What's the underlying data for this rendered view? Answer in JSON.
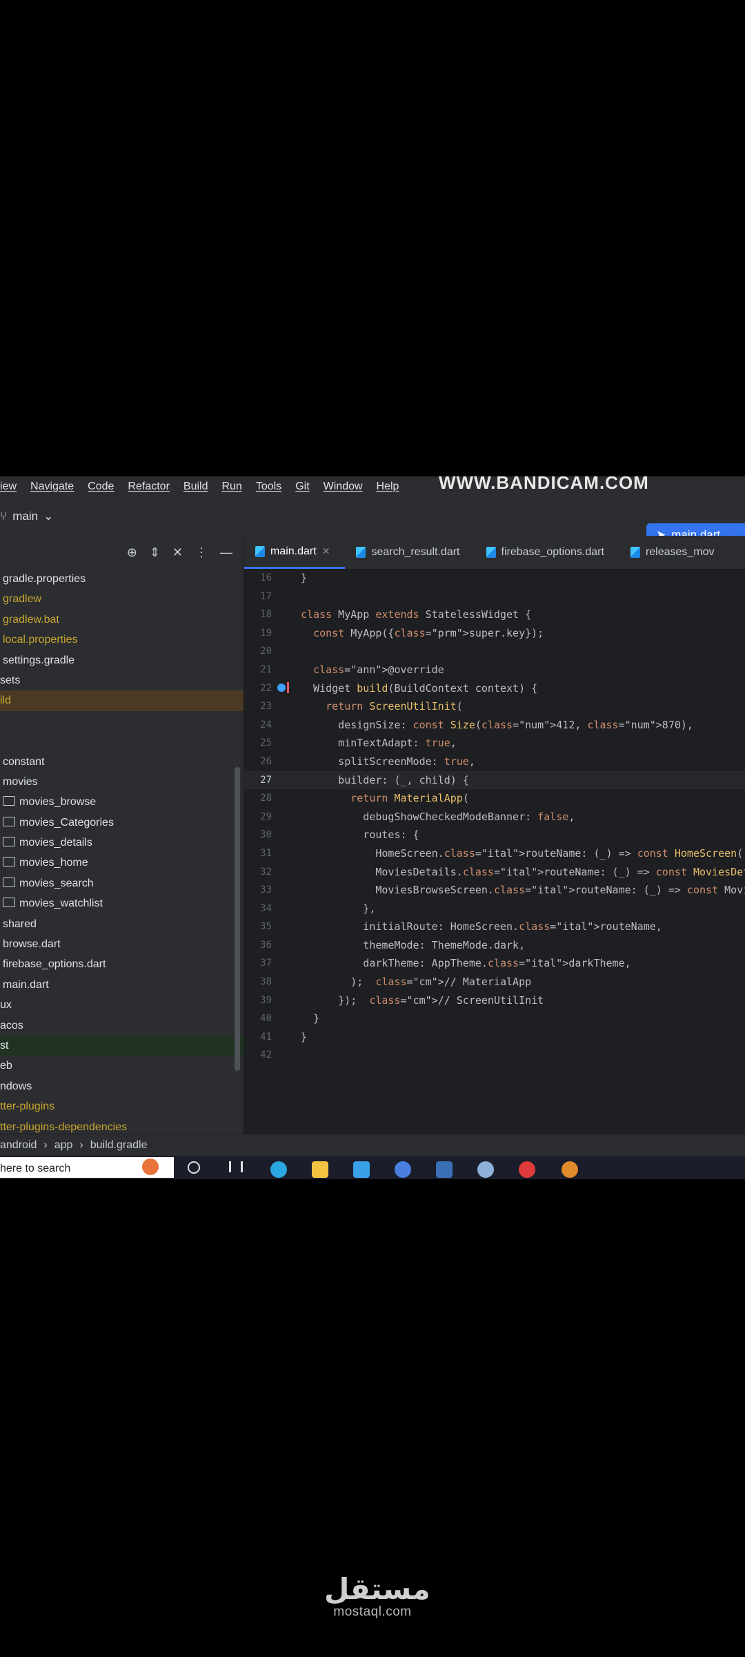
{
  "menu": [
    "iew",
    "Navigate",
    "Code",
    "Refactor",
    "Build",
    "Run",
    "Tools",
    "Git",
    "Window",
    "Help"
  ],
  "watermark": "WWW.BANDICAM.COM",
  "toolbar": {
    "branch": "main",
    "run_config": "main.dart"
  },
  "project_header_icons": [
    "target-icon",
    "expand-collapse-icon",
    "close-icon",
    "more-icon",
    "minimize-icon"
  ],
  "tree": [
    {
      "label": "gradle.properties",
      "color": "normal",
      "indent": 0
    },
    {
      "label": "gradlew",
      "color": "yellow",
      "indent": 0
    },
    {
      "label": "gradlew.bat",
      "color": "yellow",
      "indent": 0
    },
    {
      "label": "local.properties",
      "color": "yellow",
      "indent": 0
    },
    {
      "label": "settings.gradle",
      "color": "normal",
      "indent": 0
    },
    {
      "label": "sets",
      "color": "normal",
      "indent": -1
    },
    {
      "label": "ild",
      "color": "yellow",
      "indent": -1,
      "highlight": "brown"
    },
    {
      "label": "",
      "color": "normal",
      "indent": -1
    },
    {
      "label": "",
      "color": "normal",
      "indent": -1
    },
    {
      "label": "constant",
      "color": "normal",
      "indent": 0
    },
    {
      "label": "movies",
      "color": "normal",
      "indent": 0
    },
    {
      "label": "movies_browse",
      "color": "normal",
      "indent": 1,
      "folder": true
    },
    {
      "label": "movies_Categories",
      "color": "normal",
      "indent": 1,
      "folder": true
    },
    {
      "label": "movies_details",
      "color": "normal",
      "indent": 1,
      "folder": true
    },
    {
      "label": "movies_home",
      "color": "normal",
      "indent": 1,
      "folder": true
    },
    {
      "label": "movies_search",
      "color": "normal",
      "indent": 1,
      "folder": true
    },
    {
      "label": "movies_watchlist",
      "color": "normal",
      "indent": 1,
      "folder": true
    },
    {
      "label": "shared",
      "color": "normal",
      "indent": 0
    },
    {
      "label": "browse.dart",
      "color": "normal",
      "indent": 0
    },
    {
      "label": "firebase_options.dart",
      "color": "normal",
      "indent": 0
    },
    {
      "label": "main.dart",
      "color": "normal",
      "indent": 0
    },
    {
      "label": "ux",
      "color": "normal",
      "indent": -1
    },
    {
      "label": "acos",
      "color": "normal",
      "indent": -1
    },
    {
      "label": "st",
      "color": "normal",
      "indent": -1,
      "highlight": "green"
    },
    {
      "label": "eb",
      "color": "normal",
      "indent": -1
    },
    {
      "label": "ndows",
      "color": "normal",
      "indent": -1
    },
    {
      "label": "tter-plugins",
      "color": "yellow",
      "indent": -1
    },
    {
      "label": "tter-plugins-dependencies",
      "color": "yellow",
      "indent": -1
    }
  ],
  "tabs": [
    {
      "label": "main.dart",
      "active": true,
      "closable": true
    },
    {
      "label": "search_result.dart",
      "active": false
    },
    {
      "label": "firebase_options.dart",
      "active": false
    },
    {
      "label": "releases_mov",
      "active": false
    }
  ],
  "code": {
    "current_line": 27,
    "lines": [
      {
        "n": "16",
        "text": "}"
      },
      {
        "n": "17",
        "text": ""
      },
      {
        "n": "18",
        "text": "class MyApp extends StatelessWidget {"
      },
      {
        "n": "19",
        "text": "  const MyApp({super.key});"
      },
      {
        "n": "20",
        "text": ""
      },
      {
        "n": "21",
        "text": "  @override"
      },
      {
        "n": "22",
        "text": "  Widget build(BuildContext context) {"
      },
      {
        "n": "23",
        "text": "    return ScreenUtilInit("
      },
      {
        "n": "24",
        "text": "      designSize: const Size(412, 870),"
      },
      {
        "n": "25",
        "text": "      minTextAdapt: true,"
      },
      {
        "n": "26",
        "text": "      splitScreenMode: true,"
      },
      {
        "n": "27",
        "text": "      builder: (_, child) {"
      },
      {
        "n": "28",
        "text": "        return MaterialApp("
      },
      {
        "n": "29",
        "text": "          debugShowCheckedModeBanner: false,"
      },
      {
        "n": "30",
        "text": "          routes: {"
      },
      {
        "n": "31",
        "text": "            HomeScreen.routeName: (_) => const HomeScreen(),"
      },
      {
        "n": "32",
        "text": "            MoviesDetails.routeName: (_) => const MoviesDetails("
      },
      {
        "n": "33",
        "text": "            MoviesBrowseScreen.routeName: (_) => const MoviesBro"
      },
      {
        "n": "34",
        "text": "          },"
      },
      {
        "n": "35",
        "text": "          initialRoute: HomeScreen.routeName,"
      },
      {
        "n": "36",
        "text": "          themeMode: ThemeMode.dark,"
      },
      {
        "n": "37",
        "text": "          darkTheme: AppTheme.darkTheme,"
      },
      {
        "n": "38",
        "text": "        );  // MaterialApp"
      },
      {
        "n": "39",
        "text": "      });  // ScreenUtilInit"
      },
      {
        "n": "40",
        "text": "  }"
      },
      {
        "n": "41",
        "text": "}"
      },
      {
        "n": "42",
        "text": ""
      }
    ]
  },
  "status_breadcrumb": [
    "android",
    "app",
    "build.gradle"
  ],
  "taskbar": {
    "search_placeholder": "here to search"
  },
  "logo": {
    "arabic": "مستقل",
    "latin": "mostaql.com"
  }
}
